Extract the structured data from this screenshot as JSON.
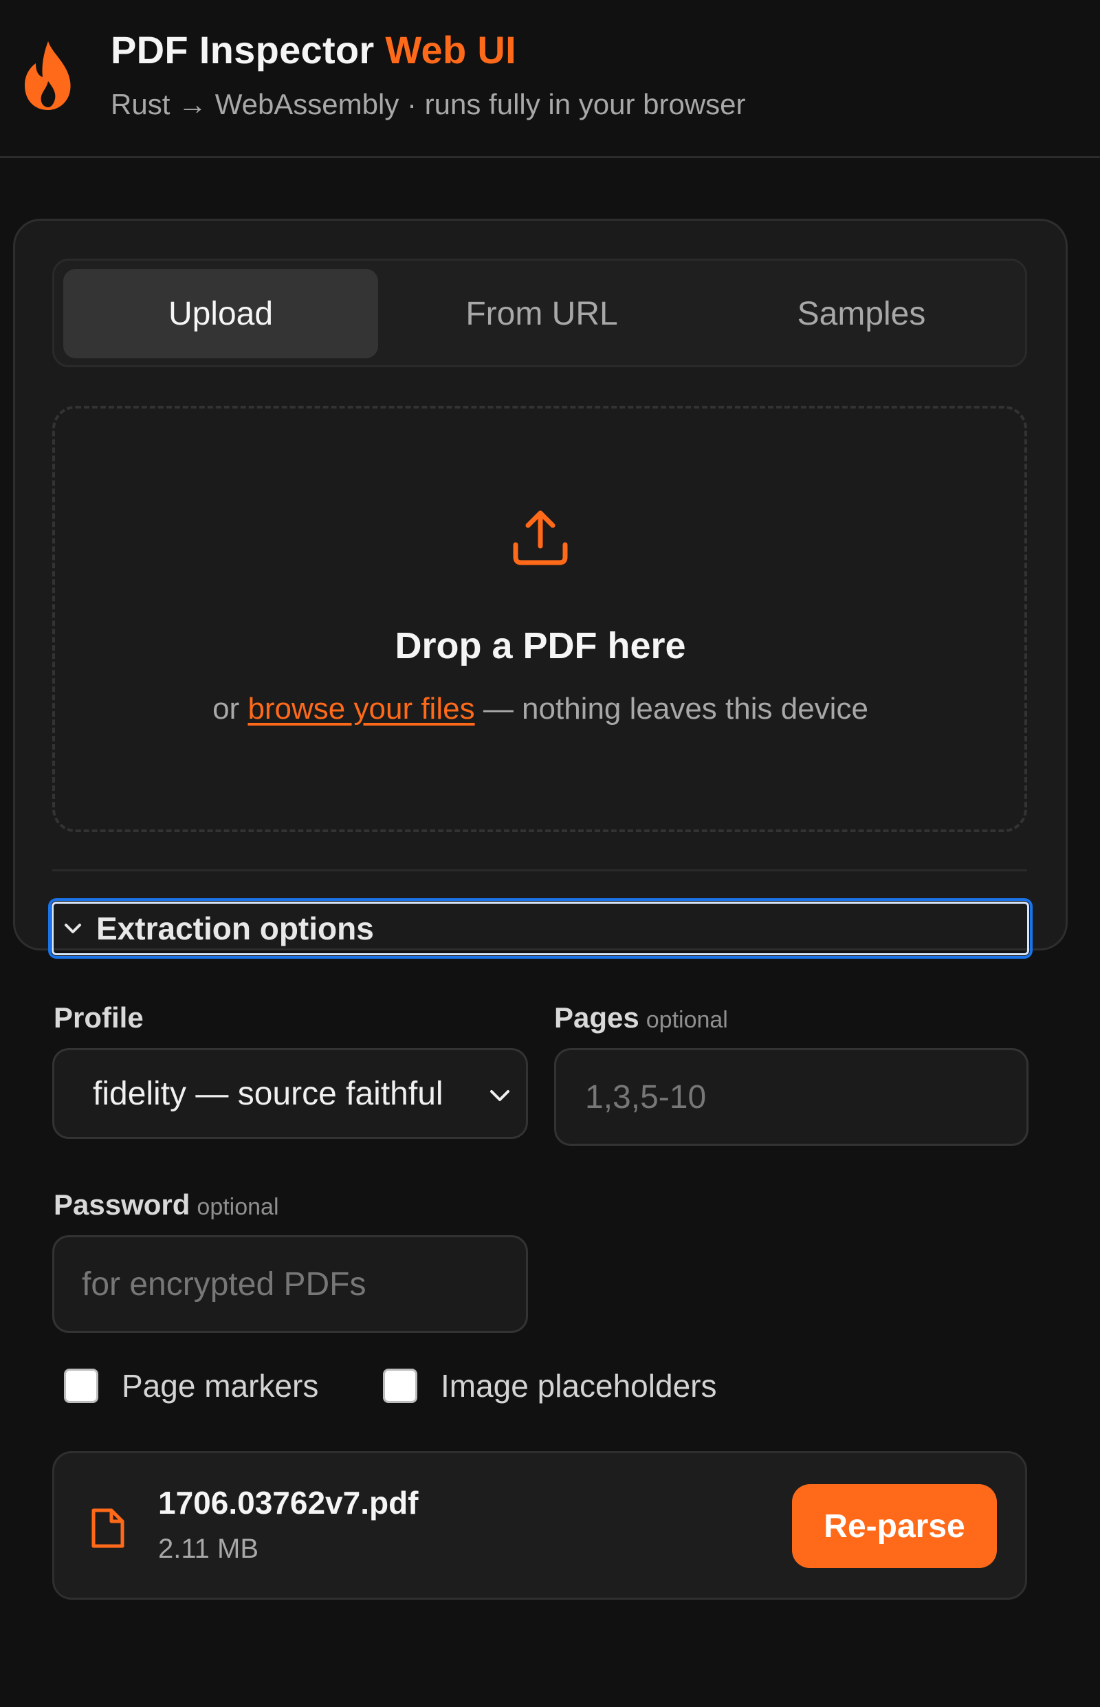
{
  "header": {
    "title_main": "PDF Inspector",
    "title_accent": "Web UI",
    "subtitle": "Rust → WebAssembly · runs fully in your browser",
    "logo_icon": "flame-icon",
    "accent_color": "#ff6a1a"
  },
  "tabs": [
    {
      "label": "Upload",
      "active": true
    },
    {
      "label": "From URL",
      "active": false
    },
    {
      "label": "Samples",
      "active": false
    }
  ],
  "dropzone": {
    "icon": "upload-icon",
    "title": "Drop a PDF here",
    "prefix": "or",
    "link_text": "browse your files",
    "suffix": "— nothing leaves this device"
  },
  "options": {
    "summary_label": "Extraction options",
    "expanded": true,
    "profile_label": "Profile",
    "profile_value": "fidelity — source faithful",
    "pages_label": "Pages",
    "pages_optional": "optional",
    "pages_placeholder": "1,3,5-10",
    "password_label": "Password",
    "password_optional": "optional",
    "password_placeholder": "for encrypted PDFs",
    "checkboxes": [
      {
        "label": "Page markers",
        "checked": false
      },
      {
        "label": "Image placeholders",
        "checked": false
      }
    ]
  },
  "file": {
    "name": "1706.03762v7.pdf",
    "size": "2.11 MB",
    "icon": "file-icon",
    "action_label": "Re-parse"
  }
}
